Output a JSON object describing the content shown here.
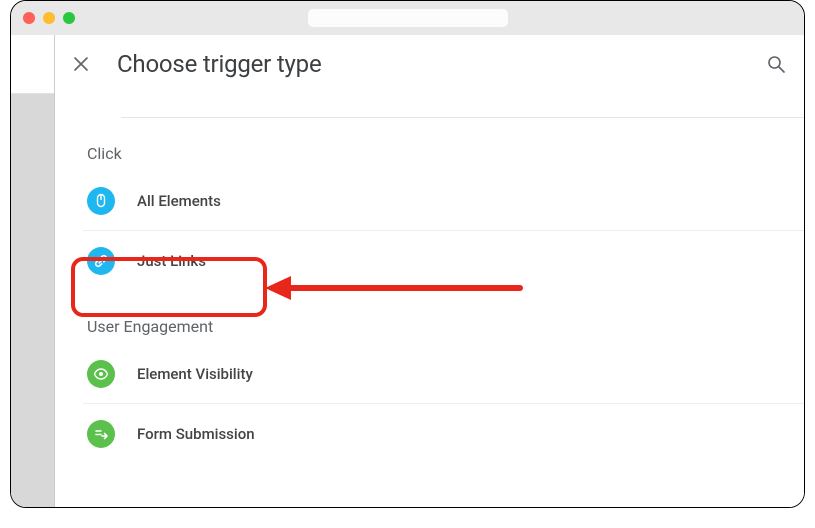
{
  "header": {
    "title": "Choose trigger type"
  },
  "sections": [
    {
      "heading": "Click",
      "items": [
        {
          "label": "All Elements",
          "icon": "mouse-icon",
          "color": "blue"
        },
        {
          "label": "Just Links",
          "icon": "link-icon",
          "color": "blue"
        }
      ]
    },
    {
      "heading": "User Engagement",
      "items": [
        {
          "label": "Element Visibility",
          "icon": "eye-icon",
          "color": "green"
        },
        {
          "label": "Form Submission",
          "icon": "form-icon",
          "color": "green"
        }
      ]
    }
  ]
}
